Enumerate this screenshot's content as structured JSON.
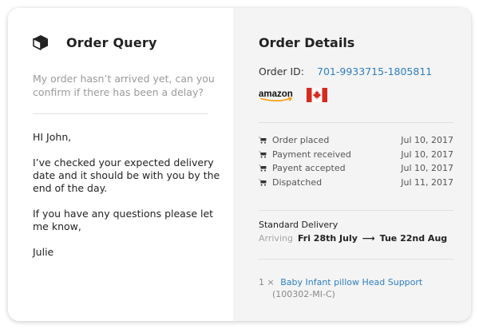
{
  "query": {
    "title": "Order Query",
    "message": "My order hasn’t arrived yet, can you confirm if there has been a delay?",
    "reply": {
      "greeting": "HI John,",
      "body1": "I’ve checked your expected delivery date and it should be with you by the end of the day.",
      "body2": "If you have any questions please let me know,",
      "signature": "Julie"
    }
  },
  "details": {
    "title": "Order Details",
    "order_id_label": "Order ID:",
    "order_id": "701-9933715-1805811",
    "brand_logo": "amazon",
    "flag": "canada-flag",
    "status": [
      {
        "label": "Order placed",
        "date": "Jul 10, 2017"
      },
      {
        "label": "Payment received",
        "date": "Jul 10, 2017"
      },
      {
        "label": "Payent accepted",
        "date": "Jul 10, 2017"
      },
      {
        "label": "Dispatched",
        "date": "Jul 11, 2017"
      }
    ],
    "delivery": {
      "type": "Standard Delivery",
      "arriving_label": "Arriving",
      "from": "Fri 28th July",
      "arrow": "⟶",
      "to": "Tue 22nd Aug"
    },
    "item": {
      "qty": "1 ×",
      "name": "Baby Infant pillow Head Support",
      "sku": "(100302-MI-C)"
    }
  },
  "colors": {
    "accent_link": "#2e7fc1",
    "panel_bg": "#f4f4f4",
    "flag_red": "#d52b1e",
    "amazon_orange": "#ff9900"
  }
}
